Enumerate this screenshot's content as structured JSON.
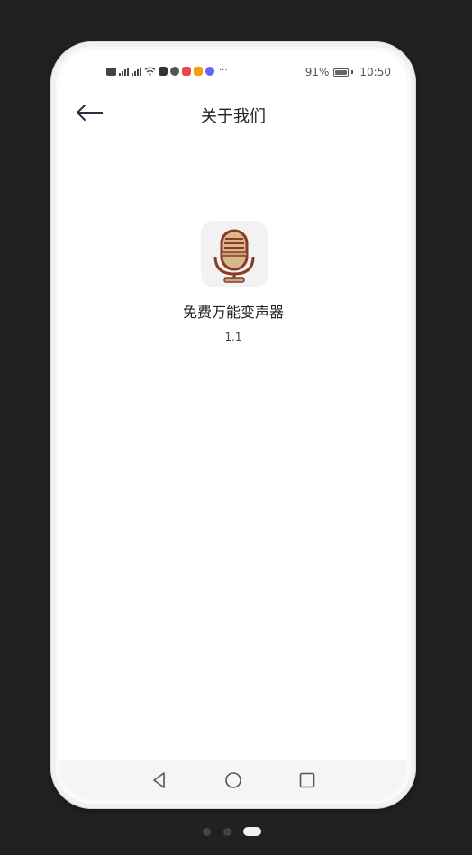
{
  "status_bar": {
    "battery": "91%",
    "time": "10:50",
    "more": "···"
  },
  "header": {
    "title": "关于我们"
  },
  "app": {
    "name": "免费万能变声器",
    "version": "1.1"
  },
  "pagination": {
    "pages": 3,
    "active": 3
  }
}
